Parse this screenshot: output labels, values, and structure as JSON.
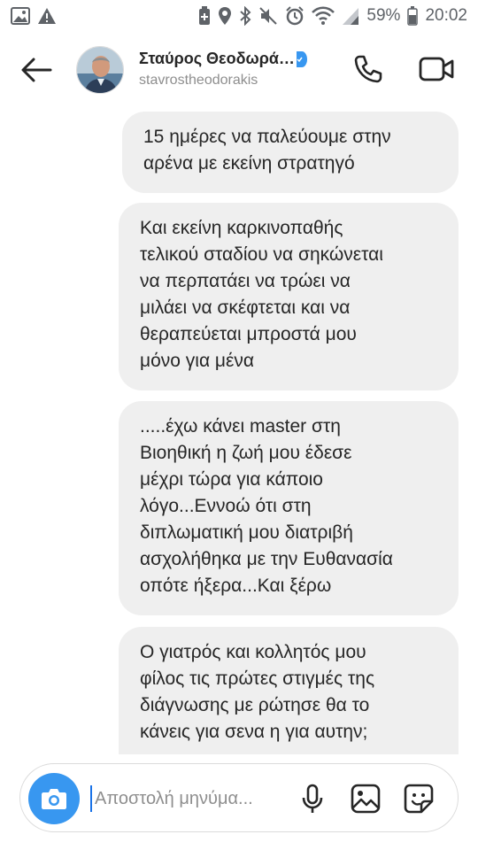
{
  "status_bar": {
    "battery": "59%",
    "time": "20:02",
    "icons": [
      "image-notification-icon",
      "warning-icon",
      "battery-saver-icon",
      "location-icon",
      "bluetooth-icon",
      "mute-icon",
      "alarm-icon",
      "wifi-icon",
      "signal-icon",
      "battery-icon"
    ]
  },
  "header": {
    "name": "Σταύρος Θεοδωρά…",
    "username": "stavrostheodorakis",
    "verified": true,
    "icons": [
      "back-arrow-icon",
      "phone-icon",
      "video-camera-icon"
    ]
  },
  "messages": [
    {
      "sender": "self",
      "text": "15 ημέρες να παλεύουμε στην\nαρένα με εκείνη στρατηγό"
    },
    {
      "sender": "self",
      "text": "Και εκείνη καρκινοπαθής\nτελικού σταδίου να σηκώνεται\nνα περπατάει να τρώει να\nμιλάει να σκέφτεται και να\nθεραπεύεται μπροστά μου\nμόνο για μένα"
    },
    {
      "sender": "self",
      "text": ".....έχω κάνει master στη\nΒιοηθική η ζωή μου έδεσε\nμέχρι τώρα για κάποιο\nλόγο...Εννοώ ότι στη\nδιπλωματική μου διατριβή\nασχολήθηκα με την Ευθανασία\nοπότε ήξερα...Και ξέρω"
    },
    {
      "sender": "self",
      "text": "Ο γιατρός και κολλητός μου\nφίλος τις πρώτες στιγμές της\nδιάγνωσης με ρώτησε θα το\nκάνεις για σενα η για αυτην;"
    }
  ],
  "composer": {
    "placeholder": "Αποστολή μηνύμα...",
    "value": "",
    "icons": [
      "camera-icon",
      "microphone-icon",
      "gallery-icon",
      "sticker-icon"
    ]
  },
  "colors": {
    "accent": "#3897f0",
    "bubble": "#efefef",
    "text": "#262626",
    "secondary_text": "#8e8e8e",
    "verified": "#3897f0"
  }
}
